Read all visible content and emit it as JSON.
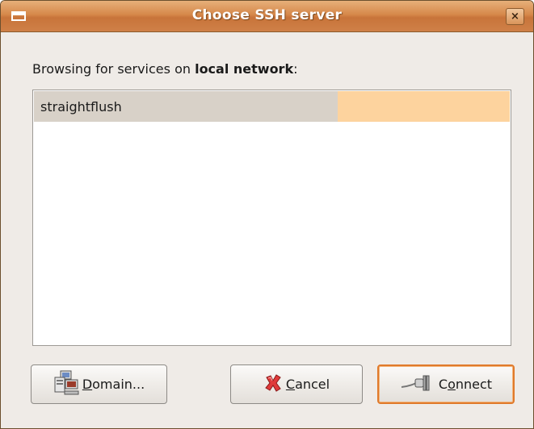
{
  "window": {
    "title": "Choose SSH server",
    "close_glyph": "×"
  },
  "browse": {
    "prefix": "Browsing for services on ",
    "network": "local network",
    "suffix": ":"
  },
  "services": [
    {
      "name": "straightflush"
    }
  ],
  "buttons": {
    "domain": {
      "mnemonic": "D",
      "rest": "omain...",
      "icon": "network-computer-icon"
    },
    "cancel": {
      "mnemonic": "C",
      "rest": "ancel",
      "icon": "cancel-x-icon"
    },
    "connect": {
      "pre": "C",
      "mnemonic": "o",
      "rest": "nnect",
      "icon": "plug-connect-icon"
    }
  },
  "colors": {
    "titlebar": "#d6884a",
    "selection_accent": "#fdd39e",
    "default_button_border": "#e07a2b"
  }
}
